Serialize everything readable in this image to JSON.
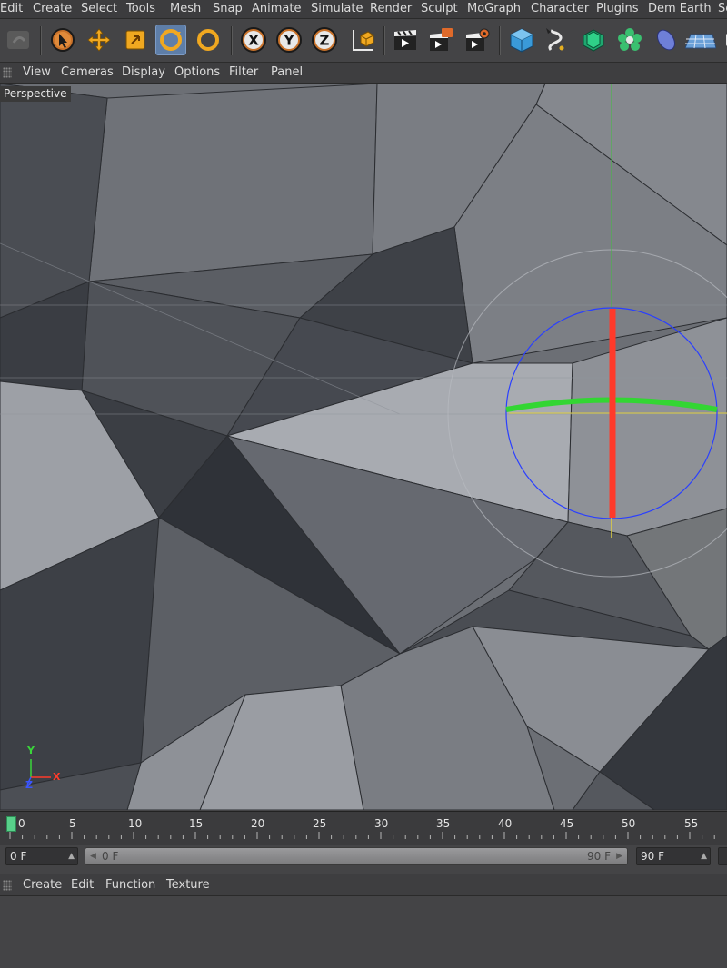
{
  "menubar": {
    "items": [
      "Edit",
      "Create",
      "Select",
      "Tools",
      "Mesh",
      "Snap",
      "Animate",
      "Simulate",
      "Render",
      "Sculpt",
      "MoGraph",
      "Character",
      "Plugins",
      "Dem Earth",
      "Sc"
    ]
  },
  "toolbar": {
    "tools": [
      "undo-icon",
      "live-selection-icon",
      "move-icon",
      "scale-icon",
      "rotate-icon",
      "rotate-recent-icon",
      "x-axis-lock-icon",
      "y-axis-lock-icon",
      "z-axis-lock-icon",
      "coordinate-system-icon",
      "render-view-icon",
      "render-picture-viewer-icon",
      "render-settings-icon",
      "cube-icon",
      "spline-pen-icon",
      "subdivision-icon",
      "cloner-icon",
      "deformer-icon",
      "floor-icon",
      "scene-icon"
    ],
    "axis_labels": [
      "X",
      "Y",
      "Z"
    ],
    "active_tool": "rotate-icon"
  },
  "viewport_menu": {
    "items": [
      "View",
      "Cameras",
      "Display",
      "Options",
      "Filter",
      "Panel"
    ]
  },
  "viewport": {
    "label": "Perspective",
    "axis_x": "X",
    "axis_y": "Y",
    "axis_z": "Z",
    "colors": {
      "x_axis": "#ff3a2a",
      "y_axis": "#3ad63a",
      "z_axis": "#3a55ff",
      "background": "#6a6d73"
    }
  },
  "timeline": {
    "ticks": [
      "0",
      "5",
      "10",
      "15",
      "20",
      "25",
      "30",
      "35",
      "40",
      "45",
      "50",
      "55"
    ],
    "current_frame": 0,
    "playhead_color": "#58d08a"
  },
  "range": {
    "start_value": "0 F",
    "slider_start": "0 F",
    "slider_end": "90 F",
    "end_value": "90 F"
  },
  "material_menu": {
    "items": [
      "Create",
      "Edit",
      "Function",
      "Texture"
    ]
  }
}
